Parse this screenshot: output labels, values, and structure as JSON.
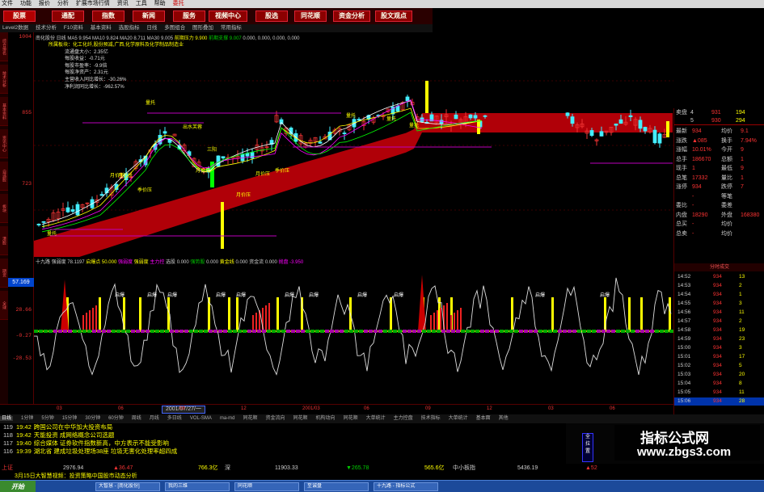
{
  "menu": [
    "文件",
    "功能",
    "报价",
    "分析",
    "扩展市场行情",
    "资讯",
    "工具",
    "帮助",
    "委托"
  ],
  "nav": [
    "股票",
    "通配",
    "指数",
    "新闻",
    "服务",
    "视频中心",
    "股选",
    "同花顺",
    "资金分析",
    "股文观点"
  ],
  "toolbar": [
    "Level2数据",
    "技术分析",
    "F10资料",
    "基本资料",
    "选股指标",
    "日线",
    "多图组合",
    "图形叠加",
    "常用指标"
  ],
  "left_tabs": [
    "综合排名",
    "技术分析",
    "基本资料",
    "资讯中心",
    "自选股",
    "板块",
    "港股",
    "期货",
    "全球"
  ],
  "y_axis": {
    "top": "1004",
    "upper": "855",
    "mid": "723",
    "ind_top": "57.169",
    "ind_mid": "28.66",
    "ind_low": "-0.27",
    "ind_bot": "-28.53"
  },
  "kline_header": {
    "name": "南化股份 日线",
    "ma1": "MA5 9.954",
    "ma2": "MA10 9.824",
    "ma3": "MA20 8.711",
    "ma4": "MA30 9.005",
    "pressure": "前期压力 9.900",
    "support": "前期支撑 9.007",
    "vals": "0.000, 0.000, 0.000, 0.000"
  },
  "info_box": {
    "title": "所属板块：化工化纤,股份预减,广西,化学原料及化学制品制造业",
    "rows": [
      {
        "label": "流通盘大小：",
        "value": "2.35亿"
      },
      {
        "label": "每股收益：",
        "value": "-0.71元"
      },
      {
        "label": "每股市盈率：",
        "value": "-9.9倍"
      },
      {
        "label": "每股净资产：",
        "value": "2.31元"
      },
      {
        "label": "主营收入同比增长：",
        "value": "-30.26%"
      },
      {
        "label": "净利润同比增长：",
        "value": "-962.57%"
      }
    ]
  },
  "chart_annotations": [
    "量托",
    "出水芙蓉",
    "量托",
    "量托",
    "季价压",
    "月价压",
    "月价压",
    "季价压",
    "月价托",
    "月价托",
    "量托",
    "量托",
    "三阳",
    "月价托"
  ],
  "lower_header": {
    "name": "十九路 强弱度",
    "v1": "78.1197",
    "v2": "启爆点 50.000",
    "v3": "强弱度",
    "v4": "强弱度",
    "v5": "主力控",
    "v6": "选股",
    "v7": "0.000",
    "v8": "强势股",
    "v9": "0.000",
    "v10": "黄金线",
    "v11": "0.000",
    "v12": "资金流 0.000",
    "v13": "抛盘 -3.950"
  },
  "lower_labels": [
    "启爆",
    "启爆",
    "启爆",
    "启爆",
    "启爆",
    "启爆",
    "启爆",
    "启爆",
    "启爆",
    "启爆",
    "启爆"
  ],
  "quote": {
    "sell": [
      {
        "l": "卖盘",
        "p": "4",
        "v1": "931",
        "v2": "194"
      },
      {
        "l": "",
        "p": "5",
        "v1": "930",
        "v2": "294"
      }
    ],
    "rows": [
      {
        "l": "最新",
        "v": "934",
        "l2": "均价",
        "v2": "9.1"
      },
      {
        "l": "涨跌",
        "v": "▲085",
        "l2": "换手",
        "v2": "7.94%"
      },
      {
        "l": "涨幅",
        "v": "10.01%",
        "l2": "今开",
        "v2": "9"
      },
      {
        "l": "总手",
        "v": "186670",
        "l2": "总额",
        "v2": "1"
      },
      {
        "l": "现手",
        "v": "1",
        "l2": "最低",
        "v2": "9"
      },
      {
        "l": "总笔",
        "v": "17332",
        "l2": "量比",
        "v2": "1"
      },
      {
        "l": "涨停",
        "v": "934",
        "l2": "跌停",
        "v2": "7"
      },
      {
        "l": "",
        "v": "-",
        "l2": "等笔",
        "v2": ""
      },
      {
        "l": "委比",
        "v": "-",
        "l2": "委差",
        "v2": ""
      },
      {
        "l": "内盘",
        "v": "18290",
        "l2": "外盘",
        "v2": "168380"
      },
      {
        "l": "总买",
        "v": "-",
        "l2": "均价",
        "v2": ""
      },
      {
        "l": "总卖",
        "v": "-",
        "l2": "均价",
        "v2": ""
      }
    ],
    "ticks_title": "分时成交",
    "ticks": [
      {
        "t": "14:52",
        "p": "934",
        "v": "13"
      },
      {
        "t": "14:53",
        "p": "934",
        "v": "2"
      },
      {
        "t": "14:54",
        "p": "934",
        "v": "1"
      },
      {
        "t": "14:55",
        "p": "934",
        "v": "3"
      },
      {
        "t": "14:56",
        "p": "934",
        "v": "11"
      },
      {
        "t": "14:57",
        "p": "934",
        "v": "2"
      },
      {
        "t": "14:58",
        "p": "934",
        "v": "19"
      },
      {
        "t": "14:59",
        "p": "934",
        "v": "23"
      },
      {
        "t": "15:00",
        "p": "934",
        "v": "3"
      },
      {
        "t": "15:01",
        "p": "934",
        "v": "17"
      },
      {
        "t": "15:02",
        "p": "934",
        "v": "5"
      },
      {
        "t": "15:03",
        "p": "934",
        "v": "20"
      },
      {
        "t": "15:04",
        "p": "934",
        "v": "8"
      },
      {
        "t": "15:05",
        "p": "934",
        "v": "11"
      },
      {
        "t": "15:06",
        "p": "934",
        "v": "28"
      }
    ]
  },
  "x_axis": {
    "date": "2001/07/27/一",
    "labels": [
      "03",
      "06",
      "09",
      "12",
      "2001/03",
      "06",
      "09",
      "12",
      "03",
      "06"
    ]
  },
  "period_tabs": [
    "日线",
    "1分钟",
    "5分钟",
    "15分钟",
    "30分钟",
    "60分钟",
    "周线",
    "月线",
    "多日线",
    "VOL-SMA",
    "ma-md",
    "同花顺",
    "资金流向",
    "同花顺",
    "机构动向",
    "同花顺",
    "大单统计",
    "主力控盘",
    "技术指标",
    "大单统计",
    "基本面",
    "其他"
  ],
  "news": [
    {
      "n": "119",
      "t": "19:42",
      "text": "跨国公司在中华加大投资布局"
    },
    {
      "n": "118",
      "t": "19:42",
      "text": "天能投资 成网络概念公司选题"
    },
    {
      "n": "117",
      "t": "19:40",
      "text": "综合媒体 证券软件指数新高，中方表示不能受影响"
    },
    {
      "n": "116",
      "t": "19:39",
      "text": "湖北省 建成垃圾处理场38座 垃圾无害化处理率超四成"
    }
  ],
  "side_btns": [
    "全",
    "拉",
    "置"
  ],
  "watermark": {
    "title": "指标公式网",
    "url": "www.zbgs3.com"
  },
  "index_bar": {
    "label1": "上证",
    "v1": "2976.94",
    "c1": "▲36.47",
    "v2": "766.3亿",
    "l2": "深",
    "v3": "11903.33",
    "c3": "▼265.78",
    "v4": "565.6亿",
    "l4": "中小板指",
    "v5": "5436.19",
    "c5": "▲52"
  },
  "ticker": "3月15日大智慧视频：投资策略中国股市动态分析",
  "taskbar": {
    "start": "开始",
    "apps": [
      "大智慧 - [南化股份]",
      "我的三维",
      "同花顺",
      "至诚盘",
      "十九路 - 指标公式"
    ]
  }
}
